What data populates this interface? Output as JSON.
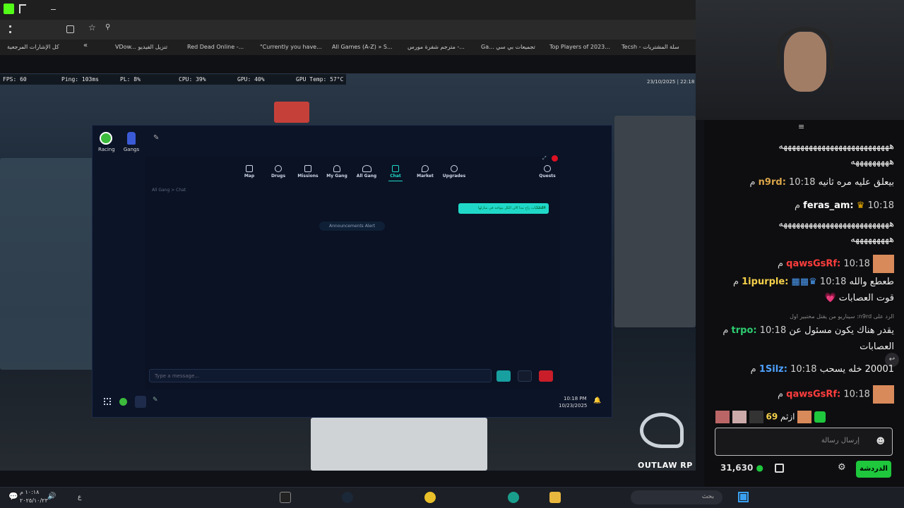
{
  "browser": {
    "bookmarks": [
      "كل الإشارات المرجعية",
      "VDow... تنزيل الفيديو",
      "Red Dead Online -...",
      "\"Currently you have...",
      "All Games (A-Z) » S...",
      "مترجم شفرة مورس -...",
      "Ga... تجميعات بي سي",
      "Top Players of 2023...",
      "Tecsh - سلة المشتريات"
    ]
  },
  "stats": {
    "fps": "FPS: 60",
    "ping": "Ping: 103ms",
    "pl": "PL: 8%",
    "cpu": "CPU: 39%",
    "gpu": "GPU: 40%",
    "gpu_temp": "GPU Temp: 57°C",
    "datetime": "23/10/2025 | 22:18"
  },
  "tablet": {
    "apps": [
      "Racing",
      "Gangs"
    ],
    "nav": [
      "Map",
      "Drugs",
      "Missions",
      "My Gang",
      "All Gang",
      "Chat",
      "Market",
      "Upgrades",
      "Quests"
    ],
    "breadcrumb": "All Gang > Chat",
    "announcement": "Announcements Alert",
    "bubble_time": "12:14",
    "bubble_text": "العصابات راح تبدا الان الكل يتواجد في منازلها",
    "message_placeholder": "Type a message...",
    "clock_time": "10:18 PM",
    "clock_date": "10/23/2025"
  },
  "chat": {
    "messages": [
      {
        "time": "",
        "user": "",
        "text": "ههههههههههههههههههههههههههه"
      },
      {
        "time": "",
        "user": "",
        "text": "هههههههههه"
      },
      {
        "time": "10:18 م",
        "user": "n9rd:",
        "text": "بيعلق عليه مره ثانيه"
      },
      {
        "time": "10:18 م",
        "user": "feras_am:",
        "text": ""
      },
      {
        "time": "",
        "user": "",
        "text": "ههههههههههههههههههههههههههه"
      },
      {
        "time": "",
        "user": "",
        "text": "هههههههههه"
      },
      {
        "time": "10:18 م",
        "user": "qawsGsRf:",
        "text": ""
      },
      {
        "time": "10:18 م",
        "user": "1ipurple:",
        "text": "طعطع والله"
      },
      {
        "time": "",
        "user": "",
        "text": "قوت العصابات 💗"
      },
      {
        "time": "",
        "user": "",
        "text": "الرد على n9rd: سيناريو من يقتل مختبير اول"
      },
      {
        "time": "10:18 م",
        "user": "trpo:",
        "text": "يقدر هناك يكون مسئول عن"
      },
      {
        "time": "",
        "user": "",
        "text": "العصابات"
      },
      {
        "time": "10:18 م",
        "user": "1Silz:",
        "text": "20001 خله يسحب"
      },
      {
        "time": "10:18 م",
        "user": "qawsGsRf:",
        "text": ""
      }
    ],
    "emote_text": "ازثم",
    "emote_num": "69",
    "input_placeholder": "إرسال رسالة",
    "points": "31,630",
    "chat_button": "الدردشة"
  },
  "overlay": {
    "brand": "OUTLAW RP"
  },
  "taskbar": {
    "search": "بحث",
    "time": "١٠:١٨ م",
    "date": "٢٠٢٥/١٠/٢٣",
    "lang": "ع"
  },
  "colors": {
    "accent_green": "#00f593",
    "chat_button": "#1ec73c",
    "user_n9rd": "#d9a54a",
    "user_qaws": "#ff3d3d",
    "user_trpo": "#2ecc71",
    "bubble": "#20d8c8"
  }
}
